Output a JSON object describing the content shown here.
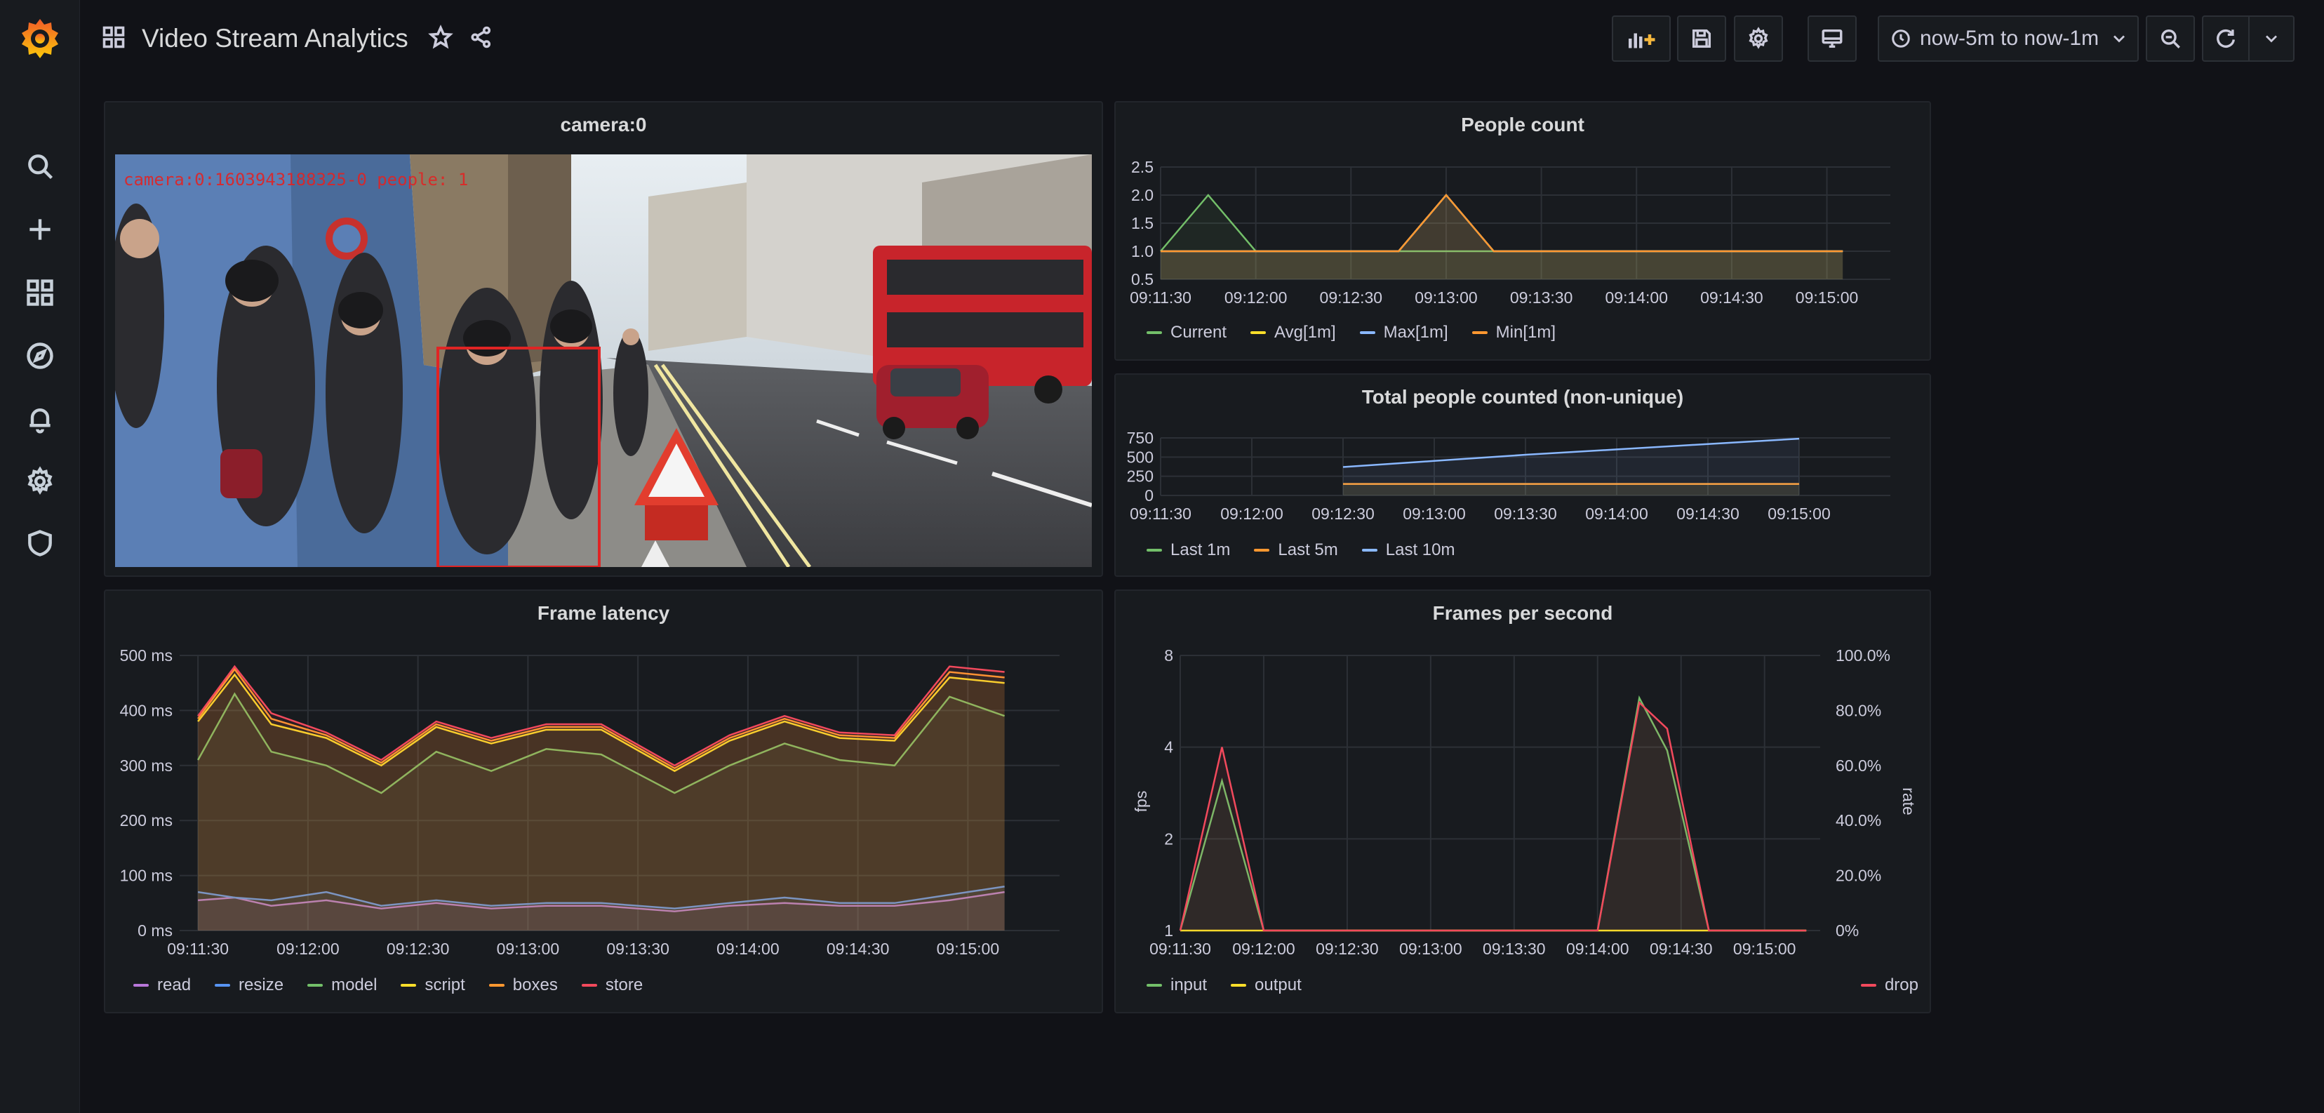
{
  "header": {
    "title": "Video Stream Analytics",
    "time_range": "now-5m to now-1m"
  },
  "sidebar": {
    "items": [
      {
        "name": "search-icon"
      },
      {
        "name": "plus-icon"
      },
      {
        "name": "dashboards-icon"
      },
      {
        "name": "compass-icon"
      },
      {
        "name": "bell-icon"
      },
      {
        "name": "gear-icon"
      },
      {
        "name": "shield-icon"
      }
    ]
  },
  "colors": {
    "green": "#73bf69",
    "yellow": "#fade2a",
    "orange": "#ff9830",
    "red": "#f2495c",
    "blue": "#5794f2",
    "purple": "#b877d9",
    "cyan": "#8ab8ff",
    "accent": "#f46800"
  },
  "panels": {
    "camera": {
      "title": "camera:0",
      "overlay_text": "camera:0:1603943188325-0 people: 1"
    },
    "people_count": {
      "title": "People count",
      "legend": [
        "Current",
        "Avg[1m]",
        "Max[1m]",
        "Min[1m]"
      ]
    },
    "total_people": {
      "title": "Total people counted (non-unique)",
      "legend": [
        "Last 1m",
        "Last 5m",
        "Last 10m"
      ]
    },
    "frame_latency": {
      "title": "Frame latency",
      "legend": [
        "read",
        "resize",
        "model",
        "script",
        "boxes",
        "store"
      ]
    },
    "fps": {
      "title": "Frames per second",
      "legend": [
        "input",
        "output"
      ],
      "legend_right": [
        "drop"
      ],
      "y_left_label": "fps",
      "y_right_label": "rate"
    }
  },
  "chart_data": [
    {
      "id": "people_count",
      "type": "area",
      "title": "People count",
      "x": [
        "09:11:30",
        "09:11:45",
        "09:12:00",
        "09:12:15",
        "09:12:30",
        "09:12:45",
        "09:13:00",
        "09:13:15",
        "09:13:30",
        "09:13:45",
        "09:14:00",
        "09:14:15",
        "09:14:30",
        "09:14:45",
        "09:15:00",
        "09:15:05"
      ],
      "x_ticks": [
        "09:11:30",
        "09:12:00",
        "09:12:30",
        "09:13:00",
        "09:13:30",
        "09:14:00",
        "09:14:30",
        "09:15:00"
      ],
      "y_ticks": [
        0.5,
        1.0,
        1.5,
        2.0,
        2.5
      ],
      "ylim": [
        0.5,
        2.5
      ],
      "series": [
        {
          "name": "Current",
          "color": "green",
          "values": [
            1,
            2,
            1,
            1,
            1,
            1,
            1,
            1,
            1,
            1,
            1,
            1,
            1,
            1,
            1,
            1
          ]
        },
        {
          "name": "Avg[1m]",
          "color": "yellow",
          "values": [
            1,
            1,
            1,
            1,
            1,
            1,
            2,
            1,
            1,
            1,
            1,
            1,
            1,
            1,
            1,
            1
          ]
        },
        {
          "name": "Max[1m]",
          "color": "cyan",
          "values": [
            1,
            1,
            1,
            1,
            1,
            1,
            2,
            1,
            1,
            1,
            1,
            1,
            1,
            1,
            1,
            1
          ]
        },
        {
          "name": "Min[1m]",
          "color": "orange",
          "values": [
            1,
            1,
            1,
            1,
            1,
            1,
            2,
            1,
            1,
            1,
            1,
            1,
            1,
            1,
            1,
            1
          ]
        }
      ]
    },
    {
      "id": "total_people",
      "type": "area",
      "title": "Total people counted (non-unique)",
      "x": [
        "09:12:30",
        "09:13:00",
        "09:13:30",
        "09:14:00",
        "09:14:30",
        "09:15:00"
      ],
      "x_ticks": [
        "09:11:30",
        "09:12:00",
        "09:12:30",
        "09:13:00",
        "09:13:30",
        "09:14:00",
        "09:14:30",
        "09:15:00"
      ],
      "x_range": [
        "09:11:30",
        "09:15:30"
      ],
      "y_ticks": [
        0,
        250,
        500,
        750
      ],
      "ylim": [
        0,
        750
      ],
      "series": [
        {
          "name": "Last 1m",
          "color": "green",
          "values": [
            150,
            150,
            150,
            150,
            150,
            150
          ]
        },
        {
          "name": "Last 5m",
          "color": "orange",
          "values": [
            150,
            150,
            150,
            150,
            150,
            150
          ]
        },
        {
          "name": "Last 10m",
          "color": "cyan",
          "values": [
            370,
            450,
            530,
            600,
            670,
            740
          ]
        }
      ]
    },
    {
      "id": "frame_latency",
      "type": "area",
      "title": "Frame latency",
      "x": [
        "09:11:30",
        "09:11:40",
        "09:11:50",
        "09:12:05",
        "09:12:20",
        "09:12:35",
        "09:12:50",
        "09:13:05",
        "09:13:20",
        "09:13:40",
        "09:13:55",
        "09:14:10",
        "09:14:25",
        "09:14:40",
        "09:14:55",
        "09:15:10"
      ],
      "x_ticks": [
        "09:11:30",
        "09:12:00",
        "09:12:30",
        "09:13:00",
        "09:13:30",
        "09:14:00",
        "09:14:30",
        "09:15:00"
      ],
      "y_ticks": [
        "0 ms",
        "100 ms",
        "200 ms",
        "300 ms",
        "400 ms",
        "500 ms"
      ],
      "ylim": [
        0,
        500
      ],
      "series": [
        {
          "name": "read",
          "color": "purple",
          "values": [
            55,
            60,
            45,
            55,
            40,
            50,
            40,
            45,
            45,
            35,
            45,
            50,
            45,
            45,
            55,
            70
          ]
        },
        {
          "name": "resize",
          "color": "blue",
          "values": [
            70,
            60,
            55,
            70,
            45,
            55,
            45,
            50,
            50,
            40,
            50,
            60,
            50,
            50,
            65,
            80
          ]
        },
        {
          "name": "model",
          "color": "green",
          "values": [
            310,
            430,
            325,
            300,
            250,
            325,
            290,
            330,
            320,
            250,
            300,
            340,
            310,
            300,
            425,
            390
          ]
        },
        {
          "name": "script",
          "color": "yellow",
          "values": [
            380,
            465,
            375,
            350,
            300,
            370,
            340,
            365,
            365,
            290,
            345,
            380,
            350,
            345,
            460,
            450
          ]
        },
        {
          "name": "boxes",
          "color": "orange",
          "values": [
            385,
            475,
            385,
            355,
            305,
            375,
            345,
            370,
            370,
            295,
            350,
            385,
            355,
            350,
            470,
            460
          ]
        },
        {
          "name": "store",
          "color": "red",
          "values": [
            390,
            480,
            395,
            360,
            310,
            380,
            350,
            375,
            375,
            300,
            355,
            390,
            360,
            355,
            480,
            470
          ]
        }
      ]
    },
    {
      "id": "fps",
      "type": "area",
      "title": "Frames per second",
      "x": [
        "09:11:30",
        "09:11:45",
        "09:12:00",
        "09:12:15",
        "09:12:30",
        "09:13:00",
        "09:13:30",
        "09:14:00",
        "09:14:15",
        "09:14:25",
        "09:14:40",
        "09:15:00",
        "09:15:15"
      ],
      "x_ticks": [
        "09:11:30",
        "09:12:00",
        "09:12:30",
        "09:13:00",
        "09:13:30",
        "09:14:00",
        "09:14:30",
        "09:15:00"
      ],
      "y_left_ticks": [
        1,
        2,
        4,
        8
      ],
      "y_left_scale": "log2",
      "y_right_ticks": [
        "0%",
        "20.0%",
        "40.0%",
        "60.0%",
        "80.0%",
        "100.0%"
      ],
      "ylim": [
        1,
        8
      ],
      "series": [
        {
          "name": "input",
          "color": "green",
          "axis": "left",
          "values": [
            1,
            3.1,
            1,
            1,
            1,
            1,
            1,
            1,
            5.8,
            3.9,
            1,
            1,
            1
          ]
        },
        {
          "name": "output",
          "color": "yellow",
          "axis": "left",
          "values": [
            1,
            1,
            1,
            1,
            1,
            1,
            1,
            1,
            1,
            1,
            1,
            1,
            1
          ]
        },
        {
          "name": "drop",
          "color": "red",
          "axis": "left",
          "values": [
            1,
            4.0,
            1,
            1,
            1,
            1,
            1,
            1,
            5.6,
            4.6,
            1,
            1,
            1
          ]
        }
      ]
    }
  ]
}
